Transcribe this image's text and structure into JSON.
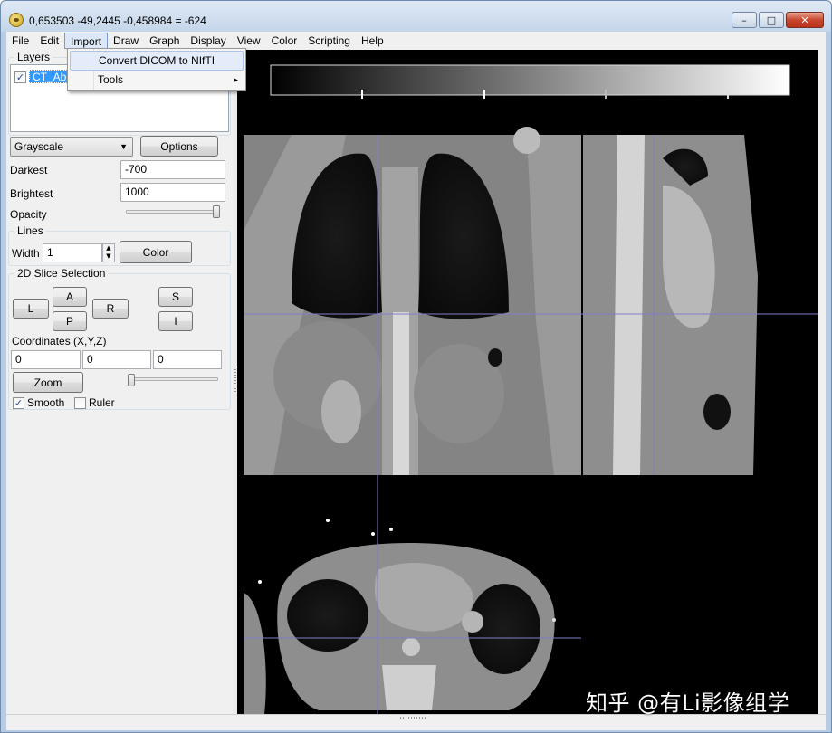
{
  "window": {
    "title": "0,653503 -49,2445 -0,458984 = -624",
    "minimize": "–",
    "maximize": "□",
    "close": "✕"
  },
  "menubar": [
    "File",
    "Edit",
    "Import",
    "Draw",
    "Graph",
    "Display",
    "View",
    "Color",
    "Scripting",
    "Help"
  ],
  "import_menu": {
    "items": [
      {
        "label": "Convert DICOM to NIfTI"
      },
      {
        "label": "Tools",
        "submenu": "▸"
      }
    ]
  },
  "layers": {
    "legend": "Layers",
    "items": [
      {
        "label": "CT_Abc",
        "checked": "✓"
      }
    ]
  },
  "color_controls": {
    "colormap": "Grayscale",
    "options_button": "Options",
    "darkest_label": "Darkest",
    "darkest_value": "-700",
    "brightest_label": "Brightest",
    "brightest_value": "1000",
    "opacity_label": "Opacity",
    "opacity_level": 1.0
  },
  "lines": {
    "legend": "Lines",
    "width_label": "Width",
    "width_value": "1",
    "color_button": "Color"
  },
  "slice_selection": {
    "legend": "2D Slice Selection",
    "buttons": {
      "L": "L",
      "A": "A",
      "P": "P",
      "R": "R",
      "S": "S",
      "I": "I"
    },
    "coordinates_label": "Coordinates (X,Y,Z)",
    "x": "0",
    "y": "0",
    "z": "0",
    "zoom_button": "Zoom",
    "zoom_level": 0.0,
    "smooth_label": "Smooth",
    "smooth_checked": "✓",
    "ruler_label": "Ruler"
  },
  "colors": {
    "selection": "#3399ff",
    "crosshair": "#7f7fc8",
    "viewer_bg": "#000000"
  },
  "watermark": "知乎 @有Li影像组学"
}
